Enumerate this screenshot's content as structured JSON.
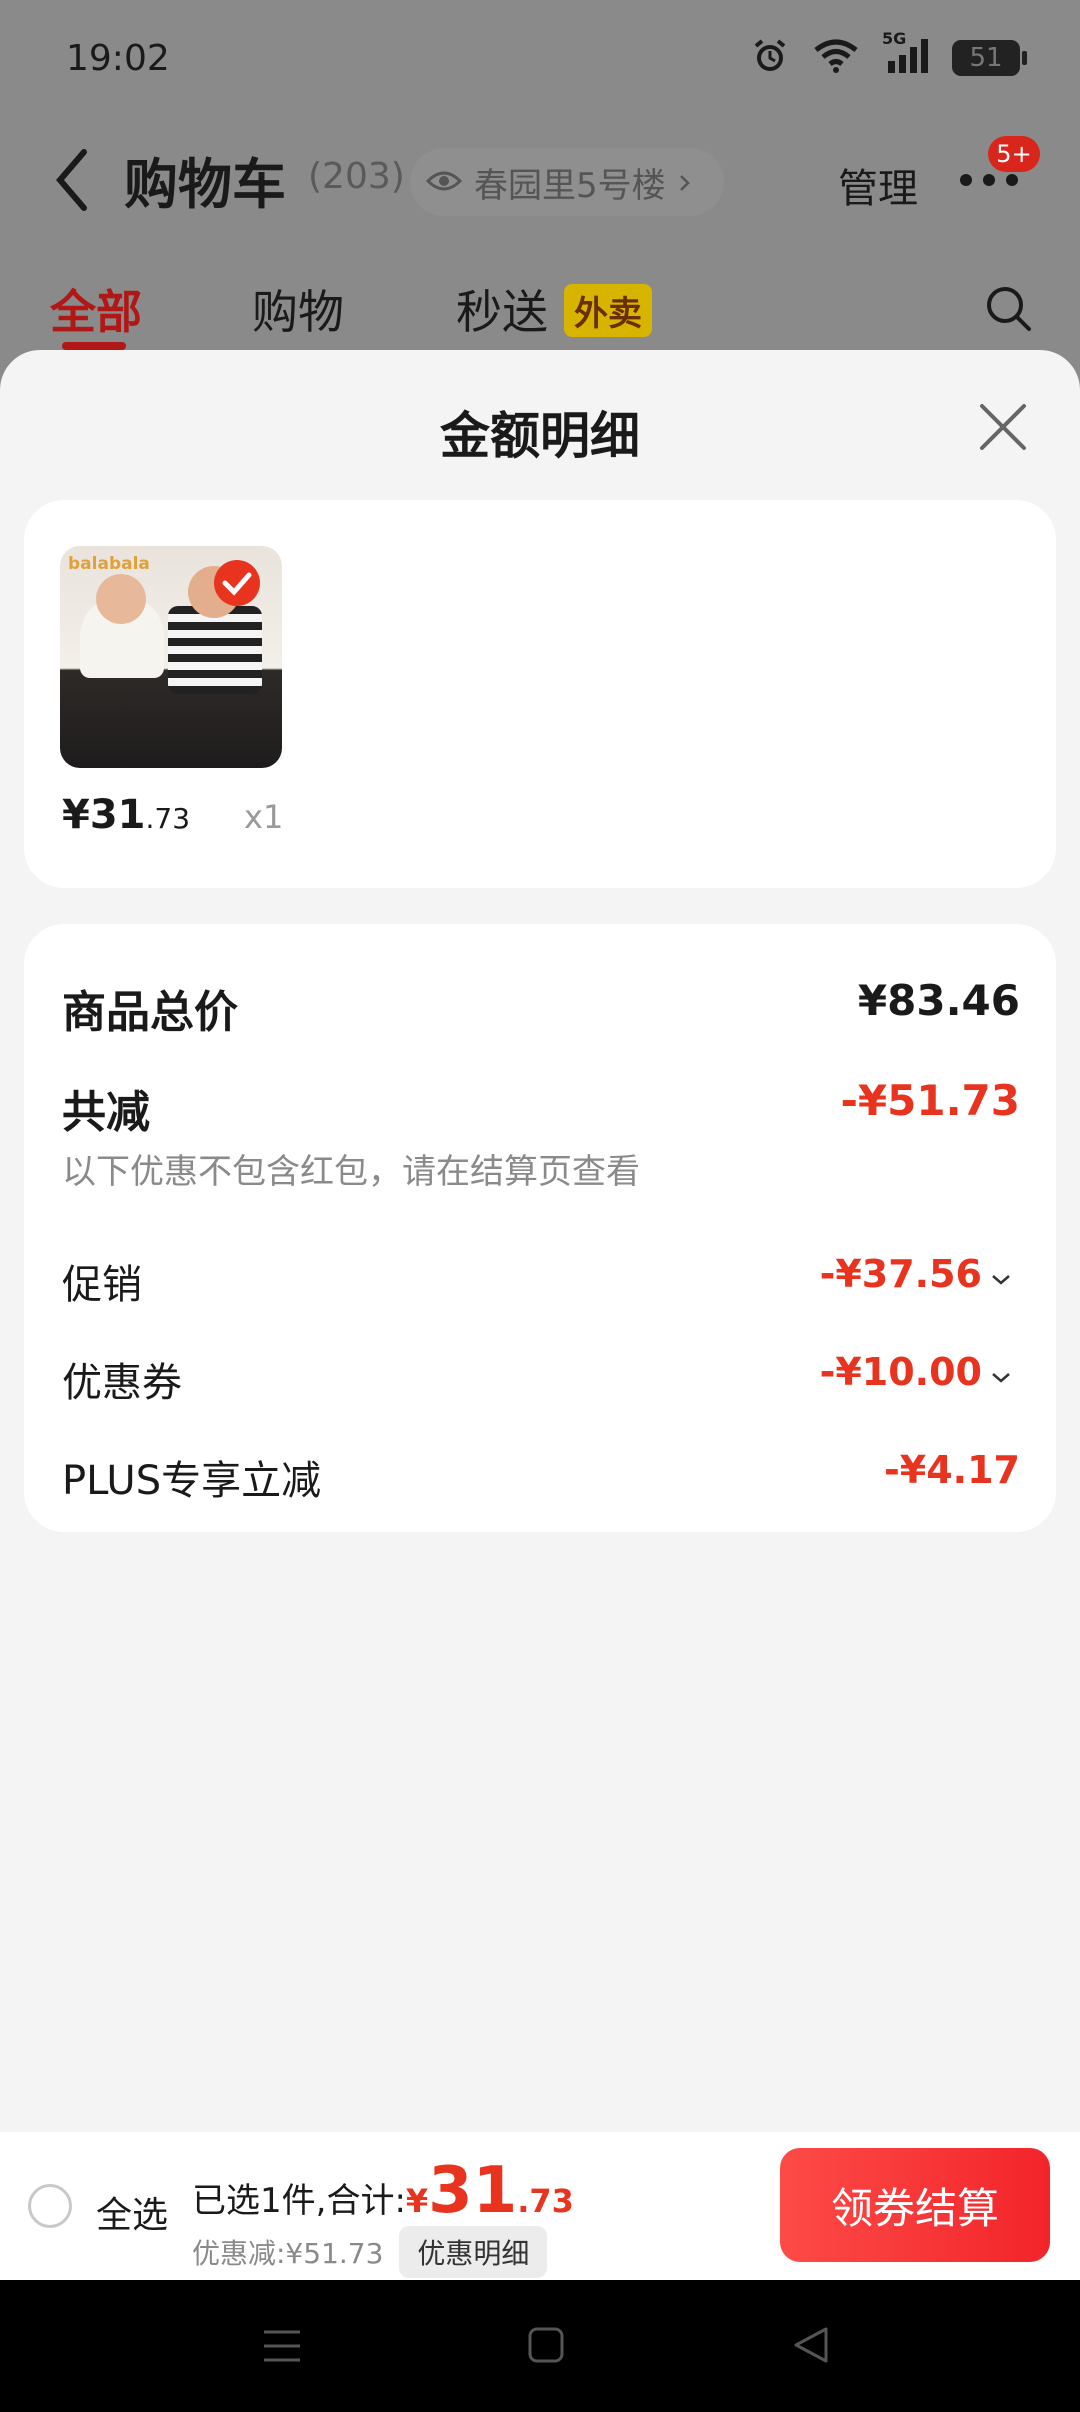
{
  "status_bar": {
    "time": "19:02",
    "network": "5G",
    "battery": "51"
  },
  "header": {
    "title": "购物车",
    "count": "(203)",
    "address": "春园里5号楼",
    "manage": "管理",
    "badge": "5+"
  },
  "tabs": [
    {
      "label": "全部"
    },
    {
      "label": "购物"
    },
    {
      "label": "秒送"
    }
  ],
  "tab_badge": "外卖",
  "sheet": {
    "title": "金额明细",
    "product": {
      "brand": "balabala",
      "price_int": "¥31",
      "price_dec": ".73",
      "qty": "x1"
    },
    "summary": {
      "total_label": "商品总价",
      "total_value": "¥83.46",
      "reduce_label": "共减",
      "reduce_value": "-¥51.73",
      "note": "以下优惠不包含红包，请在结算页查看",
      "items": [
        {
          "label": "促销",
          "value": "-¥37.56"
        },
        {
          "label": "优惠券",
          "value": "-¥10.00"
        },
        {
          "label": "PLUS专享立减",
          "value": "-¥4.17"
        }
      ]
    }
  },
  "bottom_bar": {
    "select_all": "全选",
    "selected_text": "已选1件,合计:",
    "total_symbol": "¥",
    "total_int": "31",
    "total_dec": ".73",
    "discount_text": "优惠减:¥51.73",
    "detail_link": "优惠明细",
    "checkout": "领券结算"
  },
  "colors": {
    "accent": "#e8331f",
    "tab_active": "#b01818",
    "checkout": "#f2242a"
  }
}
